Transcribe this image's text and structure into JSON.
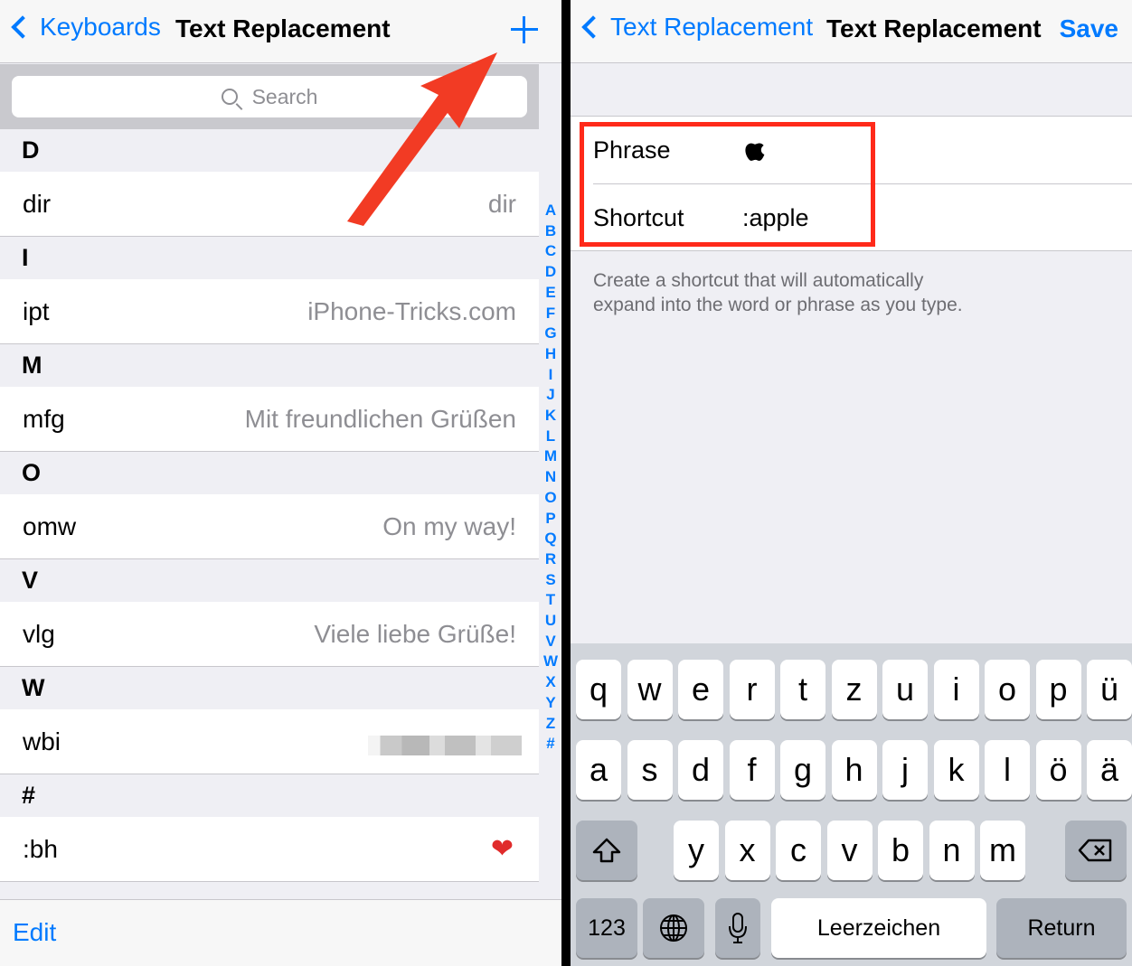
{
  "left": {
    "nav": {
      "back_label": "Keyboards",
      "title": "Text Replacement"
    },
    "search": {
      "placeholder": "Search"
    },
    "sections": [
      {
        "header": "D",
        "rows": [
          {
            "shortcut": "dir",
            "phrase": "dir"
          }
        ]
      },
      {
        "header": "I",
        "rows": [
          {
            "shortcut": "ipt",
            "phrase": "iPhone-Tricks.com"
          }
        ]
      },
      {
        "header": "M",
        "rows": [
          {
            "shortcut": "mfg",
            "phrase": "Mit freundlichen Grüßen"
          }
        ]
      },
      {
        "header": "O",
        "rows": [
          {
            "shortcut": "omw",
            "phrase": "On my way!"
          }
        ]
      },
      {
        "header": "V",
        "rows": [
          {
            "shortcut": "vlg",
            "phrase": "Viele liebe Grüße!"
          }
        ]
      },
      {
        "header": "W",
        "rows": [
          {
            "shortcut": "wbi",
            "phrase": ""
          }
        ]
      },
      {
        "header": "#",
        "rows": [
          {
            "shortcut": ":bh",
            "phrase": ""
          }
        ]
      }
    ],
    "index": [
      "A",
      "B",
      "C",
      "D",
      "E",
      "F",
      "G",
      "H",
      "I",
      "J",
      "K",
      "L",
      "M",
      "N",
      "O",
      "P",
      "Q",
      "R",
      "S",
      "T",
      "U",
      "V",
      "W",
      "X",
      "Y",
      "Z",
      "#"
    ],
    "toolbar": {
      "edit_label": "Edit"
    }
  },
  "right": {
    "nav": {
      "back_label": "Text Replacement",
      "title": "Text Replacement",
      "save_label": "Save"
    },
    "form": {
      "phrase_label": "Phrase",
      "phrase_value_icon": "apple-logo-icon",
      "shortcut_label": "Shortcut",
      "shortcut_value": ":apple"
    },
    "note": "Create a shortcut that will automatically expand into the word or phrase as you type.",
    "keyboard": {
      "row1": [
        "q",
        "w",
        "e",
        "r",
        "t",
        "z",
        "u",
        "i",
        "o",
        "p",
        "ü"
      ],
      "row2": [
        "a",
        "s",
        "d",
        "f",
        "g",
        "h",
        "j",
        "k",
        "l",
        "ö",
        "ä"
      ],
      "row3": [
        "y",
        "x",
        "c",
        "v",
        "b",
        "n",
        "m"
      ],
      "numbers_label": "123",
      "space_label": "Leerzeichen",
      "return_label": "Return"
    }
  },
  "colors": {
    "accent": "#007aff",
    "highlight": "#ff2a1a"
  }
}
